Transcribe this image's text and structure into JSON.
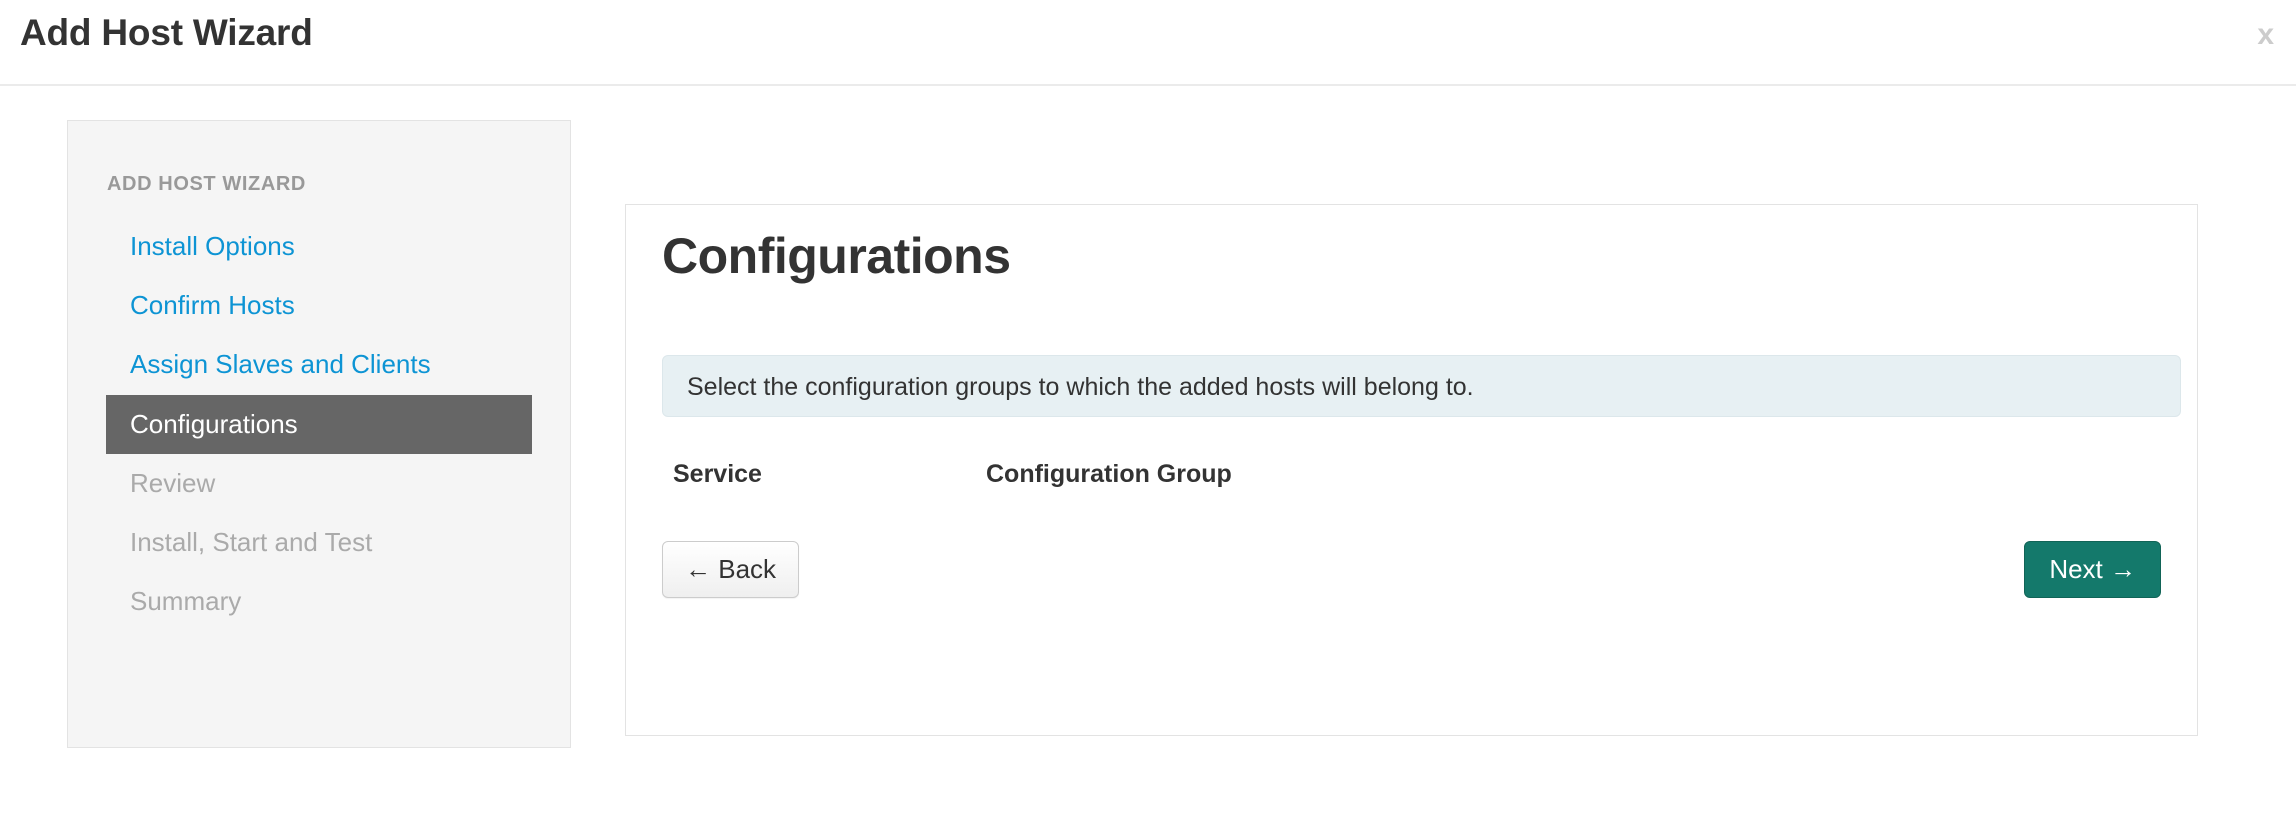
{
  "header": {
    "title": "Add Host Wizard",
    "close_label": "x"
  },
  "sidebar": {
    "heading": "ADD HOST WIZARD",
    "items": [
      {
        "label": "Install Options",
        "state": "link"
      },
      {
        "label": "Confirm Hosts",
        "state": "link"
      },
      {
        "label": "Assign Slaves and Clients",
        "state": "link"
      },
      {
        "label": "Configurations",
        "state": "active"
      },
      {
        "label": "Review",
        "state": "muted"
      },
      {
        "label": "Install, Start and Test",
        "state": "muted"
      },
      {
        "label": "Summary",
        "state": "muted"
      }
    ]
  },
  "main": {
    "title": "Configurations",
    "info_message": "Select the configuration groups to which the added hosts will belong to.",
    "table": {
      "columns": [
        "Service",
        "Configuration Group"
      ],
      "rows": []
    },
    "back_label": "← Back",
    "next_label": "Next →"
  },
  "colors": {
    "link": "#0d94d4",
    "active_bg": "#666666",
    "next_button": "#14796b",
    "info_bg": "#e7f0f3",
    "sidebar_bg": "#f5f5f5"
  }
}
